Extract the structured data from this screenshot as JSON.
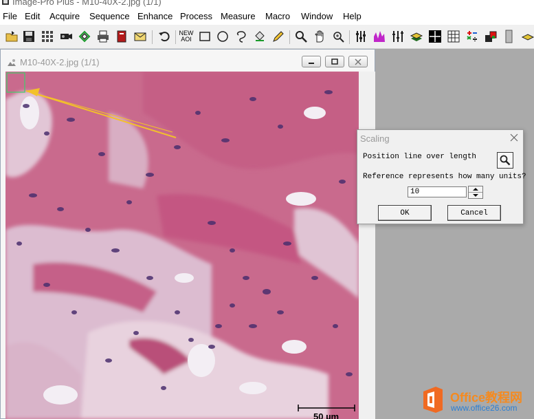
{
  "window": {
    "title": "Image-Pro Plus - M10-40X-2.jpg (1/1)"
  },
  "menu": [
    "File",
    "Edit",
    "Acquire",
    "Sequence",
    "Enhance",
    "Process",
    "Measure",
    "Macro",
    "Window",
    "Help"
  ],
  "toolbar": {
    "icons": [
      "open-file-icon",
      "save-icon",
      "grid-icon",
      "camera-icon",
      "aoi-select-icon",
      "print-icon",
      "book-icon",
      "mail-icon",
      "undo-icon",
      "new-aoi-icon",
      "rectangle-icon",
      "ellipse-icon",
      "freehand-icon",
      "flood-fill-icon",
      "pencil-icon",
      "zoom-icon",
      "hand-icon",
      "magnify-glass-icon",
      "sliders-icon",
      "histogram-icon",
      "adjust-icon",
      "layers-icon",
      "crosshair-icon",
      "grid-table-icon",
      "calculator-icon",
      "overlay-icon",
      "gray-bar-icon"
    ],
    "new_aoi_label_1": "NEW",
    "new_aoi_label_2": "AOI"
  },
  "image_window": {
    "title": "M10-40X-2.jpg (1/1)",
    "scale_bar_label": "50 µm",
    "colors": {
      "tissue": "#c7688a",
      "nuclei": "#4b2f6e",
      "measure_line": "#f3c12a",
      "selection_box": "#3ed16a"
    }
  },
  "scaling_dialog": {
    "title": "Scaling",
    "instruction": "Position line over length",
    "question": "Reference represents how many units?",
    "units_value": "10",
    "ok_label": "OK",
    "cancel_label": "Cancel"
  },
  "watermark": {
    "brand": "Office教程网",
    "url": "www.office26.com"
  }
}
